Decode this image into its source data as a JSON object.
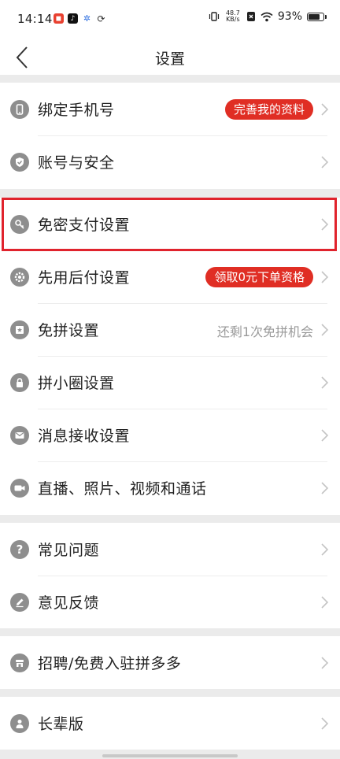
{
  "status_bar": {
    "time": "14:14",
    "network_speed_value": "48.7",
    "network_speed_unit": "KB/s",
    "battery": "93%",
    "battery_level": 0.93,
    "icons": [
      "app-icon-red",
      "tiktok-icon",
      "app-icon-blue",
      "sync-icon",
      "vibrate-icon",
      "sim-off-icon",
      "wifi-icon",
      "battery-icon"
    ]
  },
  "nav": {
    "title": "设置",
    "back_icon": "back-chevron-icon"
  },
  "groups": [
    {
      "items": [
        {
          "label": "绑定手机号",
          "icon": "phone-icon",
          "badge": "完善我的资料"
        },
        {
          "label": "账号与安全",
          "icon": "shield-icon"
        }
      ]
    },
    {
      "items": [
        {
          "label": "免密支付设置",
          "icon": "key-icon",
          "highlighted": true
        },
        {
          "label": "先用后付设置",
          "icon": "gear-icon",
          "badge": "领取0元下单资格"
        },
        {
          "label": "免拼设置",
          "icon": "ticket-icon",
          "hint": "还剩1次免拼机会"
        },
        {
          "label": "拼小圈设置",
          "icon": "lock-icon"
        },
        {
          "label": "消息接收设置",
          "icon": "mail-icon"
        },
        {
          "label": "直播、照片、视频和通话",
          "icon": "video-icon"
        }
      ]
    },
    {
      "items": [
        {
          "label": "常见问题",
          "icon": "question-icon"
        },
        {
          "label": "意见反馈",
          "icon": "pen-icon"
        }
      ]
    },
    {
      "items": [
        {
          "label": "招聘/免费入驻拼多多",
          "icon": "store-icon"
        }
      ]
    },
    {
      "items": [
        {
          "label": "长辈版",
          "icon": "elder-icon"
        }
      ]
    }
  ],
  "colors": {
    "accent_red": "#e02e24",
    "highlight_border": "#e0232d",
    "icon_gray": "#8e8e8e",
    "background": "#ebebeb"
  }
}
